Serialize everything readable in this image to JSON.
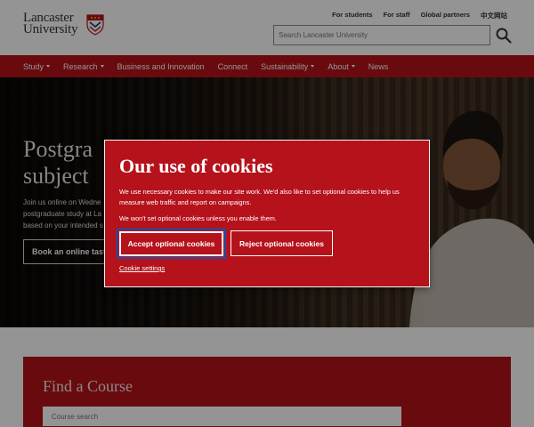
{
  "brand": {
    "name_line1": "Lancaster",
    "name_line2": "University",
    "accent": "#b5121b"
  },
  "utility_nav": [
    "For students",
    "For staff",
    "Global partners",
    "中文网站"
  ],
  "search": {
    "placeholder": "Search Lancaster University",
    "icon": "search-icon"
  },
  "main_nav": [
    {
      "label": "Study",
      "has_dropdown": true
    },
    {
      "label": "Research",
      "has_dropdown": true
    },
    {
      "label": "Business and Innovation",
      "has_dropdown": false
    },
    {
      "label": "Connect",
      "has_dropdown": false
    },
    {
      "label": "Sustainability",
      "has_dropdown": true
    },
    {
      "label": "About",
      "has_dropdown": true
    },
    {
      "label": "News",
      "has_dropdown": false
    }
  ],
  "hero": {
    "title_line1": "Postgra",
    "title_line2": "subject",
    "text_line1": "Join us online on Wedne",
    "text_line2": "postgraduate study at La",
    "text_line3": "based on your intended s",
    "button_label": "Book an online taste"
  },
  "find_course": {
    "title": "Find a Course",
    "placeholder": "Course search"
  },
  "cookie_modal": {
    "title": "Our use of cookies",
    "paragraph1": "We use necessary cookies to make our site work. We'd also like to set optional cookies to help us measure web traffic and report on campaigns.",
    "paragraph2": "We won't set optional cookies unless you enable them.",
    "accept_label": "Accept optional cookies",
    "reject_label": "Reject optional cookies",
    "settings_link": "Cookie settings"
  }
}
